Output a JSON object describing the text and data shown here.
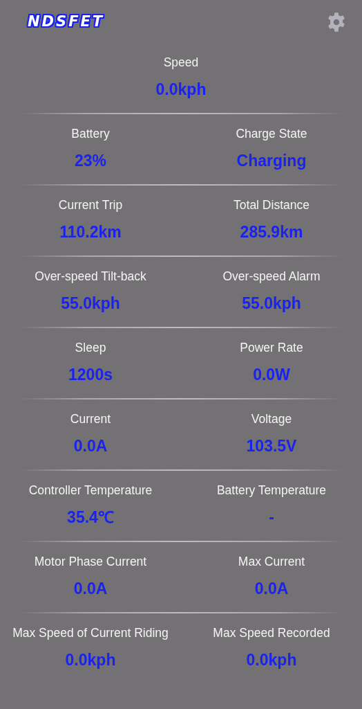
{
  "logo": "NDSFET",
  "speed": {
    "label": "Speed",
    "value": "0.0kph"
  },
  "rows": [
    [
      {
        "label": "Battery",
        "value": "23%"
      },
      {
        "label": "Charge State",
        "value": "Charging"
      }
    ],
    [
      {
        "label": "Current Trip",
        "value": "110.2km"
      },
      {
        "label": "Total Distance",
        "value": "285.9km"
      }
    ],
    [
      {
        "label": "Over-speed Tilt-back",
        "value": "55.0kph"
      },
      {
        "label": "Over-speed Alarm",
        "value": "55.0kph"
      }
    ],
    [
      {
        "label": "Sleep",
        "value": "1200s"
      },
      {
        "label": "Power Rate",
        "value": "0.0W"
      }
    ],
    [
      {
        "label": "Current",
        "value": "0.0A"
      },
      {
        "label": "Voltage",
        "value": "103.5V"
      }
    ],
    [
      {
        "label": "Controller Temperature",
        "value": "35.4℃"
      },
      {
        "label": "Battery Temperature",
        "value": "-"
      }
    ],
    [
      {
        "label": "Motor Phase Current",
        "value": "0.0A"
      },
      {
        "label": "Max Current",
        "value": "0.0A"
      }
    ],
    [
      {
        "label": "Max Speed of Current Riding",
        "value": "0.0kph"
      },
      {
        "label": "Max Speed Recorded",
        "value": "0.0kph"
      }
    ]
  ]
}
